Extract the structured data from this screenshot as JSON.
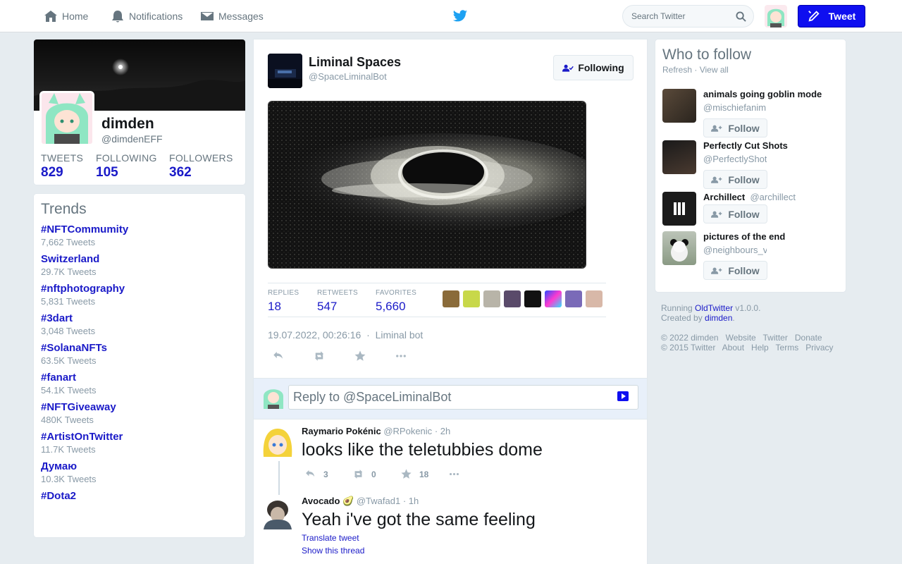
{
  "nav": {
    "home": "Home",
    "notifications": "Notifications",
    "messages": "Messages",
    "search_placeholder": "Search Twitter",
    "tweet_button": "Tweet"
  },
  "profile": {
    "name": "dimden",
    "handle": "@dimdenEFF",
    "stats": [
      {
        "label": "TWEETS",
        "value": "829"
      },
      {
        "label": "FOLLOWING",
        "value": "105"
      },
      {
        "label": "FOLLOWERS",
        "value": "362"
      }
    ]
  },
  "trends": {
    "title": "Trends",
    "items": [
      {
        "name": "#NFTCommumity",
        "count": "7,662 Tweets"
      },
      {
        "name": "Switzerland",
        "count": "29.7K Tweets"
      },
      {
        "name": "#nftphotography",
        "count": "5,831 Tweets"
      },
      {
        "name": "#3dart",
        "count": "3,048 Tweets"
      },
      {
        "name": "#SolanaNFTs",
        "count": "63.5K Tweets"
      },
      {
        "name": "#fanart",
        "count": "54.1K Tweets"
      },
      {
        "name": "#NFTGiveaway",
        "count": "480K Tweets"
      },
      {
        "name": "#ArtistOnTwitter",
        "count": "11.7K Tweets"
      },
      {
        "name": "Думаю",
        "count": "10.3K Tweets"
      },
      {
        "name": "#Dota2",
        "count": ""
      }
    ]
  },
  "tweet": {
    "name": "Liminal Spaces",
    "handle": "@SpaceLiminalBot",
    "follow_state": "Following",
    "replies_label": "REPLIES",
    "replies": "18",
    "retweets_label": "RETWEETS",
    "retweets": "547",
    "favorites_label": "FAVORITES",
    "favorites": "5,660",
    "date": "19.07.2022, 00:26:16",
    "separator": "·",
    "source": "Liminal bot",
    "reply_placeholder": "Reply to @SpaceLiminalBot"
  },
  "replies": [
    {
      "name": "Raymario Pokénic",
      "handle": "@RPokenic",
      "time": "· 2h",
      "text": "looks like the teletubbies dome",
      "reply_count": "3",
      "retweet_count": "0",
      "like_count": "18"
    },
    {
      "name": "Avocado 🥑",
      "handle": "@Twafad1",
      "time": "· 1h",
      "text": "Yeah i've got the same feeling",
      "translate": "Translate tweet",
      "show_thread": "Show this thread"
    }
  ],
  "who_to_follow": {
    "title": "Who to follow",
    "refresh": "Refresh",
    "separator": "·",
    "view_all": "View all",
    "follow_label": "Follow",
    "users": [
      {
        "name": "animals going goblin mode",
        "handle": "@mischiefanim"
      },
      {
        "name": "Perfectly Cut Shots",
        "handle": "@PerfectlyShot"
      },
      {
        "name": "Archillect",
        "handle": "@archillect"
      },
      {
        "name": "pictures of the end",
        "handle": "@neighbours_v"
      }
    ]
  },
  "footer": {
    "running": "Running",
    "app": "OldTwitter",
    "version": "v1.0.0.",
    "created_by": "Created by",
    "author": "dimden",
    "period": ".",
    "line3": [
      "© 2022 dimden",
      "Website",
      "Twitter",
      "Donate"
    ],
    "line4": [
      "© 2015 Twitter",
      "About",
      "Help",
      "Terms",
      "Privacy"
    ]
  },
  "colors": {
    "accent": "#0f0ff0",
    "link": "#1a1ac8",
    "muted": "#8899a6",
    "background": "#e6ecf0"
  }
}
